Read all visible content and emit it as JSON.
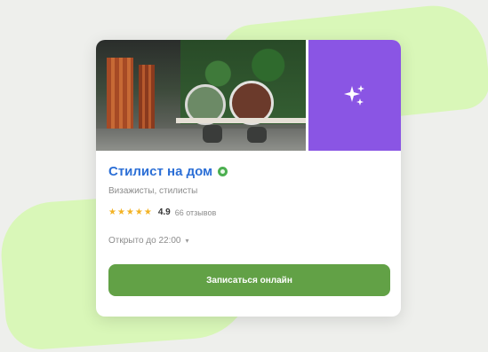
{
  "colors": {
    "background": "#eeefec",
    "blob": "#d9f7b8",
    "title": "#2c6fd6",
    "ai_tile": "#8a55e4",
    "button": "#62a146",
    "stars": "#f3b325",
    "verified": "#4caf50"
  },
  "card": {
    "gallery": {
      "photo_icon": "salon-interior-photo",
      "ai_icon": "sparkles-icon"
    },
    "title": "Стилист на дом",
    "subtitle": "Визажисты, стилисты",
    "rating": {
      "stars": "★★★★★",
      "value": "4.9",
      "reviews": "66 отзывов"
    },
    "hours": "Открыто до 22:00",
    "hours_icon": "chevron-down-icon",
    "button_label": "Записаться онлайн"
  }
}
